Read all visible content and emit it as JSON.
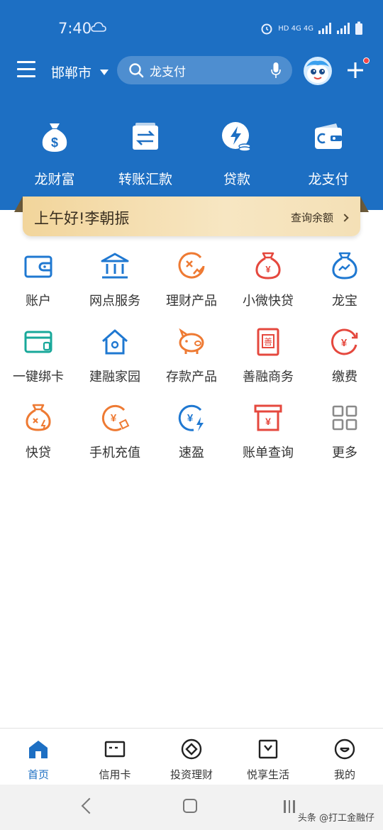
{
  "status_bar": {
    "time": "7:40",
    "indicators": "HD 4G 4G"
  },
  "topbar": {
    "city": "邯郸市",
    "search_placeholder": "龙支付",
    "menu_icon": "menu-icon",
    "avatar_icon": "mascot-avatar",
    "plus_icon": "plus-icon"
  },
  "quick_actions": [
    {
      "label": "龙财富",
      "icon": "money-bag-icon"
    },
    {
      "label": "转账汇款",
      "icon": "transfer-icon"
    },
    {
      "label": "贷款",
      "icon": "loan-icon"
    },
    {
      "label": "龙支付",
      "icon": "wallet-icon"
    }
  ],
  "banner": {
    "greeting": "上午好!李朝振",
    "link": "查询余额"
  },
  "services": [
    {
      "label": "账户",
      "icon": "wallet-icon",
      "color": "#1f78d1"
    },
    {
      "label": "网点服务",
      "icon": "bank-icon",
      "color": "#1f78d1"
    },
    {
      "label": "理财产品",
      "icon": "coin-chart-icon",
      "color": "#ee7a33"
    },
    {
      "label": "小微快贷",
      "icon": "money-bag-icon",
      "color": "#e5483e"
    },
    {
      "label": "龙宝",
      "icon": "dragon-bag-icon",
      "color": "#1f78d1"
    },
    {
      "label": "一键绑卡",
      "icon": "card-bind-icon",
      "color": "#18a89a"
    },
    {
      "label": "建融家园",
      "icon": "home-icon",
      "color": "#1f78d1"
    },
    {
      "label": "存款产品",
      "icon": "piggy-bank-icon",
      "color": "#ee7a33"
    },
    {
      "label": "善融商务",
      "icon": "shop-icon",
      "color": "#e5483e"
    },
    {
      "label": "缴费",
      "icon": "yuan-refresh-icon",
      "color": "#e5483e"
    },
    {
      "label": "快贷",
      "icon": "quick-loan-icon",
      "color": "#ee7a33"
    },
    {
      "label": "手机充值",
      "icon": "phone-topup-icon",
      "color": "#ee7a33"
    },
    {
      "label": "速盈",
      "icon": "fast-profit-icon",
      "color": "#1f78d1"
    },
    {
      "label": "账单查询",
      "icon": "bill-icon",
      "color": "#e5483e"
    },
    {
      "label": "更多",
      "icon": "grid-more-icon",
      "color": "#8a8a8a"
    }
  ],
  "bottom_nav": [
    {
      "label": "首页",
      "icon": "home-nav-icon",
      "active": true
    },
    {
      "label": "信用卡",
      "icon": "credit-card-icon",
      "active": false
    },
    {
      "label": "投资理财",
      "icon": "invest-icon",
      "active": false
    },
    {
      "label": "悦享生活",
      "icon": "life-icon",
      "active": false
    },
    {
      "label": "我的",
      "icon": "profile-icon",
      "active": false
    }
  ],
  "watermark": "头条 @打工金融仔",
  "colors": {
    "brand_blue": "#1d6fc3",
    "accent_orange": "#ee7a33",
    "accent_red": "#e5483e"
  }
}
